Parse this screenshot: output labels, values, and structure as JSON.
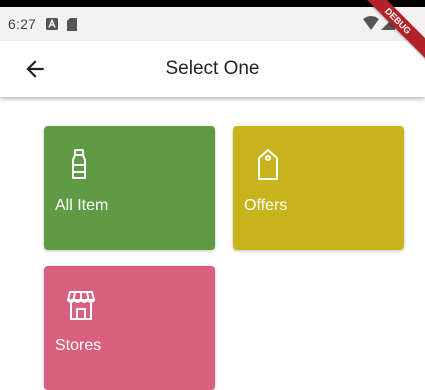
{
  "status_bar": {
    "time": "6:27",
    "notification_icons": [
      "a-icon",
      "sim-card-icon"
    ],
    "system_icons": [
      "wifi-icon",
      "signal-icon"
    ]
  },
  "app_bar": {
    "title": "Select One",
    "back_icon": "arrow-left-icon"
  },
  "debug_banner": {
    "text": "DEBUG",
    "color": "#b32129"
  },
  "tiles": [
    {
      "label": "All Item",
      "icon": "bottle-icon",
      "color": "#5f9b44"
    },
    {
      "label": "Offers",
      "icon": "tag-icon",
      "color": "#c8b31c"
    },
    {
      "label": "Stores",
      "icon": "store-icon",
      "color": "#d95f7f"
    }
  ]
}
